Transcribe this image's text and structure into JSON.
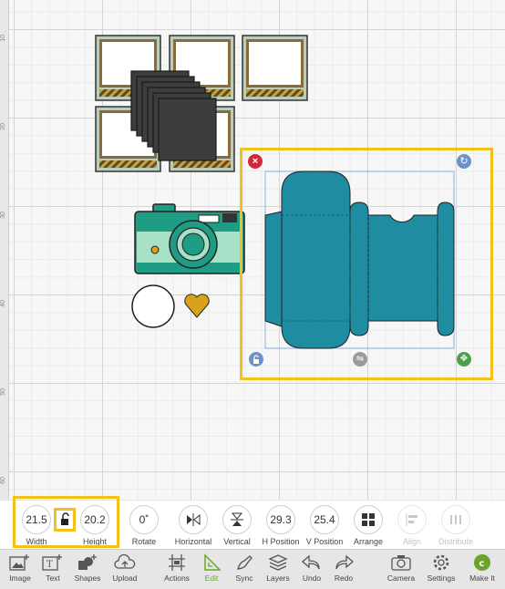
{
  "ruler": {
    "marks": [
      "10",
      "20",
      "30",
      "40",
      "50",
      "60"
    ]
  },
  "edit_toolbar": {
    "width": {
      "value": "21.5",
      "label": "Width"
    },
    "height": {
      "value": "20.2",
      "label": "Height"
    },
    "rotate": {
      "value": "0˚",
      "label": "Rotate"
    },
    "horizontal": {
      "label": "Horizontal"
    },
    "vertical": {
      "label": "Vertical"
    },
    "h_position": {
      "value": "29.3",
      "label": "H Position"
    },
    "v_position": {
      "value": "25.4",
      "label": "V Position"
    },
    "arrange": {
      "label": "Arrange"
    },
    "align": {
      "label": "Align"
    },
    "distribute": {
      "label": "Distribute"
    }
  },
  "bottom_nav": {
    "image": "Image",
    "text": "Text",
    "shapes": "Shapes",
    "upload": "Upload",
    "actions": "Actions",
    "edit": "Edit",
    "sync": "Sync",
    "layers": "Layers",
    "undo": "Undo",
    "redo": "Redo",
    "camera": "Camera",
    "settings": "Settings",
    "make_it": "Make It"
  },
  "colors": {
    "highlight": "#f2c21b",
    "teal_box": "#1f8ca1",
    "accent_green": "#6aa52a",
    "camera_green": "#1e9c84"
  }
}
